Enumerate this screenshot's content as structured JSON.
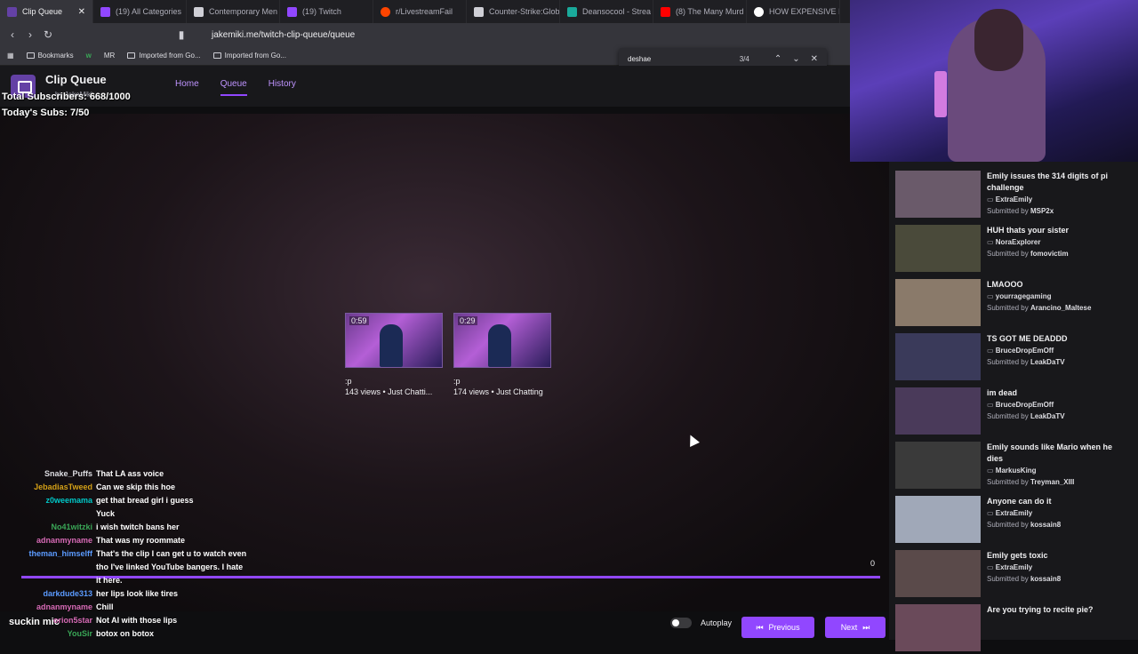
{
  "browser": {
    "tabs": [
      {
        "label": "Clip Queue",
        "color": "#6441a5"
      },
      {
        "label": "(19) All Categories",
        "color": "#9147ff"
      },
      {
        "label": "Contemporary Men",
        "color": "#cfcfd6"
      },
      {
        "label": "(19) Twitch",
        "color": "#9147ff"
      },
      {
        "label": "r/LivestreamFail",
        "color": "#ff4500"
      },
      {
        "label": "Counter-Strike:Glob",
        "color": "#cfcfd6"
      },
      {
        "label": "Deansocool - Strea",
        "color": "#1aaa9b"
      },
      {
        "label": "(8) The Many Murd",
        "color": "#ff0000"
      },
      {
        "label": "HOW EXPENSIVE IS",
        "color": "#ffffff"
      }
    ],
    "url": "jakemiki.me/twitch-clip-queue/queue",
    "bookmarks": [
      "Bookmarks",
      "w",
      "MR",
      "Imported from Go...",
      "Imported from Go..."
    ],
    "find": {
      "query": "deshae",
      "count": "3/4"
    }
  },
  "app": {
    "title": "Clip Queue",
    "subtitle": "by JakeMiki",
    "nav": [
      "Home",
      "Queue",
      "History"
    ]
  },
  "overlay": {
    "total_subs": "Total Subscribers: 668/1000",
    "today_subs": "Today's Subs: 7/50"
  },
  "player": {
    "clips": [
      {
        "duration": "0:59",
        "title": ":p",
        "meta": "143 views • Just Chatti..."
      },
      {
        "duration": "0:29",
        "title": ":p",
        "meta": "174 views • Just Chatting"
      }
    ],
    "count": "0",
    "brand": "twitch"
  },
  "chat": [
    {
      "user": "Snake_Puffs",
      "text": "That LA ass voice",
      "color": "#dedee3"
    },
    {
      "user": "JebadiasTweed",
      "text": "Can we skip this hoe",
      "color": "#d4a017"
    },
    {
      "user": "z0weemama",
      "text": "get that bread girl i guess",
      "color": "#00c8c8"
    },
    {
      "user": "",
      "text": "Yuck",
      "color": "#dedee3"
    },
    {
      "user": "No41witzki",
      "text": "i wish twitch bans her",
      "color": "#3aa757"
    },
    {
      "user": "adnanmyname",
      "text": "That was my roommate",
      "color": "#d66ab5"
    },
    {
      "user": "theman_himselff",
      "text": "That's the clip I can get u to watch even tho I've linked YouTube bangers. I hate it here.",
      "color": "#5b9bff"
    },
    {
      "user": "darkdude313",
      "text": "her lips look like tires",
      "color": "#5b9bff"
    },
    {
      "user": "adnanmyname",
      "text": "Chill",
      "color": "#d66ab5"
    },
    {
      "user": "orion5star",
      "text": "Not AI with those lips",
      "color": "#d66ab5"
    },
    {
      "user": "YouSir",
      "text": "botox on botox",
      "color": "#3aa757"
    }
  ],
  "footer": {
    "note": "suckin mic",
    "autoplay": "Autoplay",
    "previous": "Previous",
    "next": "Next"
  },
  "queue": [
    {
      "title": "Emily issues the 314 digits of pi challenge",
      "channel": "ExtraEmily",
      "submitted_by": "MSP2x"
    },
    {
      "title": "HUH thats your sister",
      "channel": "NoraExplorer",
      "submitted_by": "fomovictim"
    },
    {
      "title": "LMAOOO",
      "channel": "yourragegaming",
      "submitted_by": "Arancino_Maltese"
    },
    {
      "title": "TS GOT ME DEADDD",
      "channel": "BruceDropEmOff",
      "submitted_by": "LeakDaTV"
    },
    {
      "title": "im dead",
      "channel": "BruceDropEmOff",
      "submitted_by": "LeakDaTV"
    },
    {
      "title": "Emily sounds like Mario when he dies",
      "channel": "MarkusKing",
      "submitted_by": "Treyman_XIII"
    },
    {
      "title": "Anyone can do it",
      "channel": "ExtraEmily",
      "submitted_by": "kossain8"
    },
    {
      "title": "Emily gets toxic",
      "channel": "ExtraEmily",
      "submitted_by": "kossain8"
    },
    {
      "title": "Are you trying to recite pie?",
      "channel": "",
      "submitted_by": ""
    }
  ],
  "labels": {
    "submitted_by": "Submitted by"
  }
}
